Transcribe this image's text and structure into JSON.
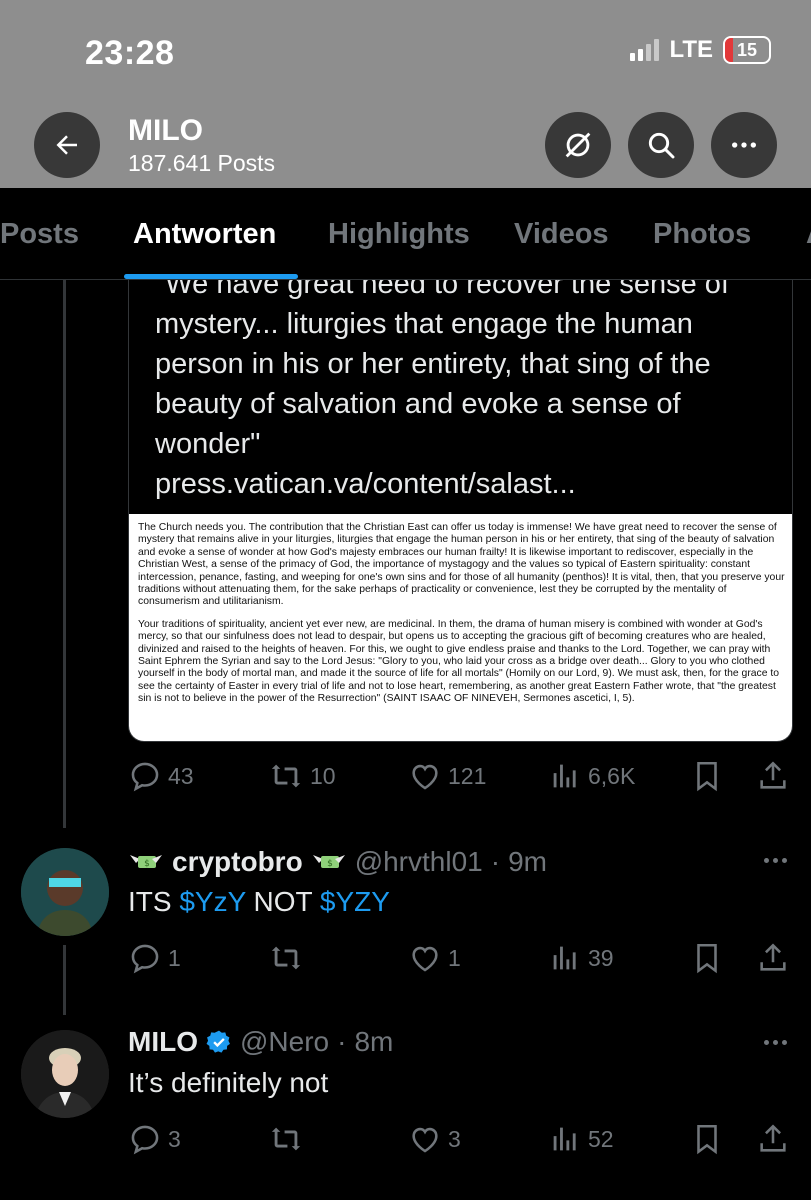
{
  "status_bar": {
    "time": "23:28",
    "network": "LTE",
    "battery": "15"
  },
  "header": {
    "name": "MILO",
    "post_count": "187.641 Posts"
  },
  "tabs": [
    {
      "label": "Posts"
    },
    {
      "label": "Antworten"
    },
    {
      "label": "Highlights"
    },
    {
      "label": "Videos"
    },
    {
      "label": "Photos"
    }
  ],
  "active_tab": "Antworten",
  "quote": {
    "text": "\"We have great need to recover the sense of mystery... liturgies that engage the human person in his or her entirety, that sing of the beauty of salvation and evoke a sense of wonder\"",
    "link": "press.vatican.va/content/salast...",
    "doc_paragraph_1": "The Church needs you. The contribution that the Christian East can offer us today is immense! We have great need to recover the sense of mystery that remains alive in your liturgies, liturgies that engage the human person in his or her entirety, that sing of the beauty of salvation and evoke a sense of wonder at how God's majesty embraces our human frailty! It is likewise important to rediscover, especially in the Christian West, a sense of the primacy of God, the importance of mystagogy and the values so typical of Eastern spirituality: constant intercession, penance, fasting, and weeping for one's own sins and for those of all humanity (penthos)! It is vital, then, that you preserve your traditions without attenuating them, for the sake perhaps of practicality or convenience, lest they be corrupted by the mentality of consumerism and utilitarianism.",
    "doc_paragraph_2": "Your traditions of spirituality, ancient yet ever new, are medicinal. In them, the drama of human misery is combined with wonder at God's mercy, so that our sinfulness does not lead to despair, but opens us to accepting the gracious gift of becoming creatures who are healed, divinized and raised to the heights of heaven. For this, we ought to give endless praise and thanks to the Lord. Together, we can pray with Saint Ephrem the Syrian and say to the Lord Jesus: \"Glory to you, who laid your cross as a bridge over death... Glory to you who clothed yourself in the body of mortal man, and made it the source of life for all mortals\" (Homily on our Lord, 9). We must ask, then, for the grace to see the certainty of Easter in every trial of life and not to lose heart, remembering, as another great Eastern Father wrote, that \"the greatest sin is not to believe in the power of the Resurrection\" (SAINT ISAAC OF NINEVEH, Sermones ascetici, I, 5).",
    "actions": {
      "replies": "43",
      "reposts": "10",
      "likes": "121",
      "views": "6,6K"
    }
  },
  "reply1": {
    "name": "cryptobro",
    "handle": "@hrvthl01",
    "time": "9m",
    "text_a": "ITS ",
    "cashtag_a": "$YzY",
    "text_b": " NOT ",
    "cashtag_b": "$YZY",
    "actions": {
      "replies": "1",
      "reposts": "",
      "likes": "1",
      "views": "39"
    }
  },
  "reply2": {
    "name": "MILO",
    "handle": "@Nero",
    "time": "8m",
    "text": "It’s definitely not",
    "actions": {
      "replies": "3",
      "reposts": "",
      "likes": "3",
      "views": "52"
    }
  },
  "colors": {
    "accent": "#1d9bf0",
    "muted": "#71767b",
    "background": "#000000",
    "header_grey": "#8e8e8e"
  }
}
